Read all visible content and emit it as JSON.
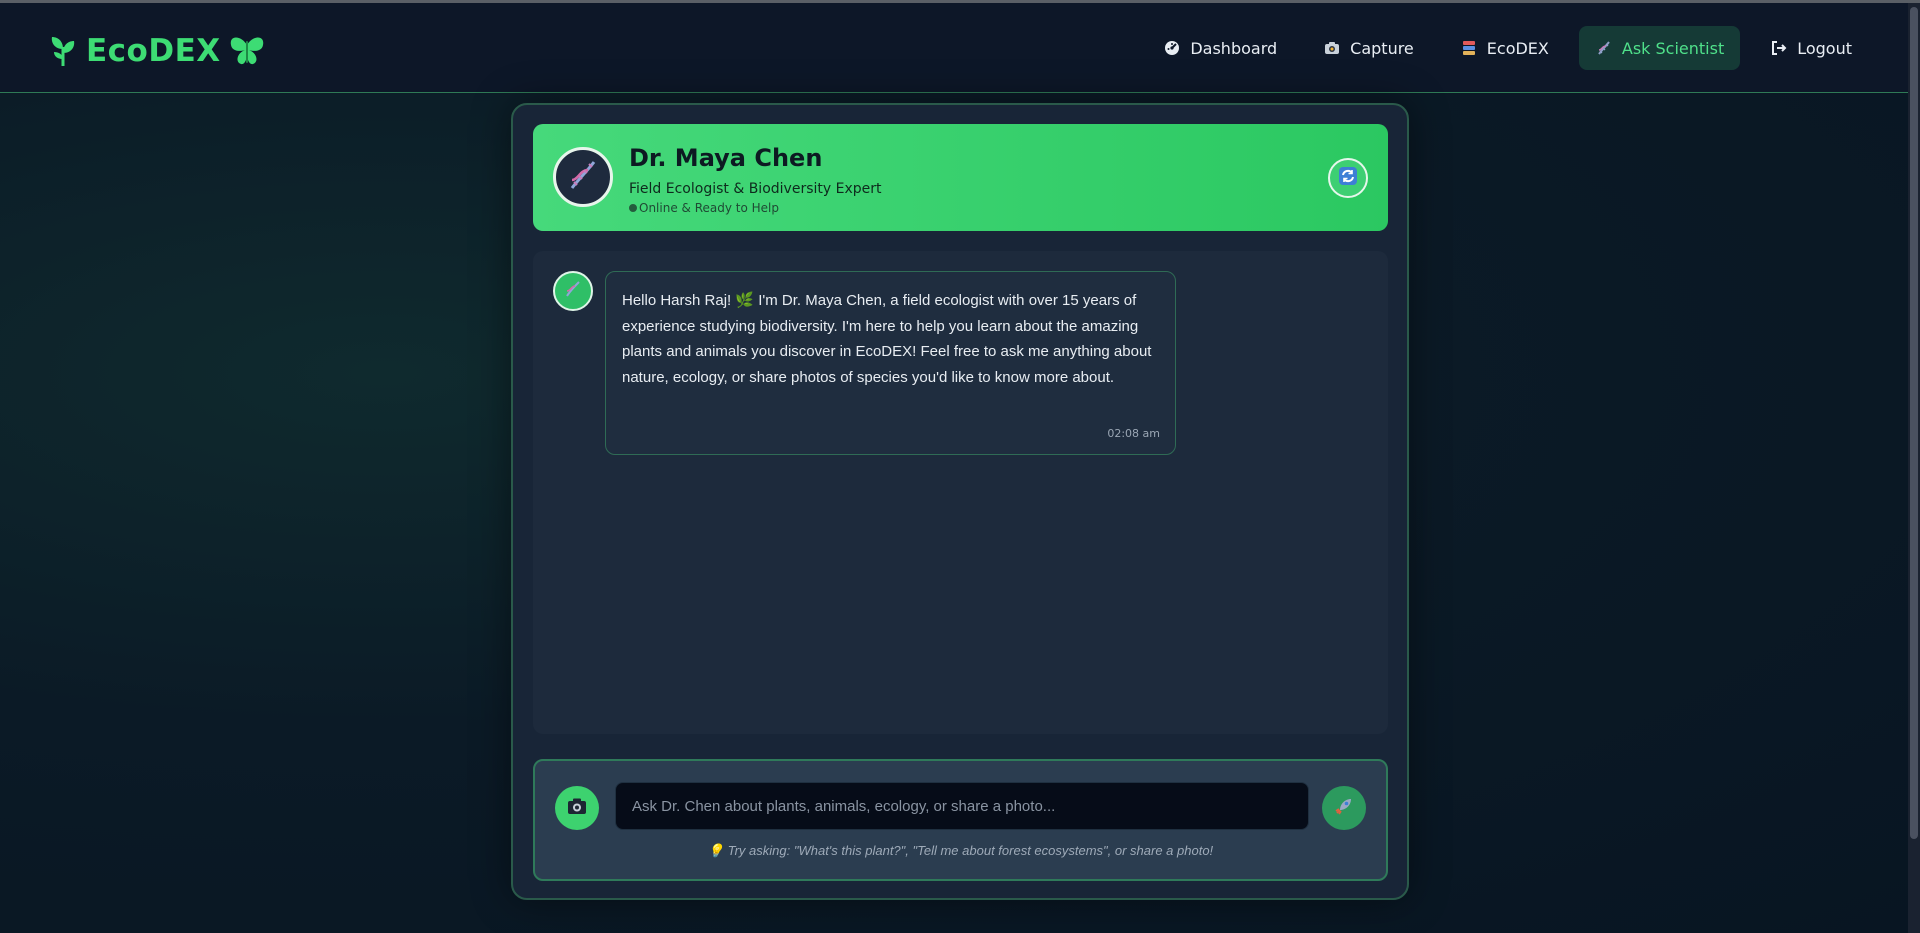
{
  "app": {
    "brand": "EcoDEX",
    "brand_color": "#3ddc74"
  },
  "nav": {
    "items": [
      {
        "label": "Dashboard",
        "icon": "dashboard-icon"
      },
      {
        "label": "Capture",
        "icon": "camera-icon"
      },
      {
        "label": "EcoDEX",
        "icon": "books-icon"
      },
      {
        "label": "Ask Scientist",
        "icon": "dna-icon",
        "active": true
      },
      {
        "label": "Logout",
        "icon": "logout-icon"
      }
    ]
  },
  "scientist": {
    "name": "Dr. Maya Chen",
    "title": "Field Ecologist & Biodiversity Expert",
    "status": "Online & Ready to Help"
  },
  "messages": [
    {
      "sender": "scientist",
      "text": "Hello Harsh Raj! 🌿 I'm Dr. Maya Chen, a field ecologist with over 15 years of experience studying biodiversity. I'm here to help you learn about the amazing plants and animals you discover in EcoDEX! Feel free to ask me anything about nature, ecology, or share photos of species you'd like to know more about.",
      "time": "02:08 am"
    }
  ],
  "composer": {
    "placeholder": "Ask Dr. Chen about plants, animals, ecology, or share a photo...",
    "value": "",
    "hint": "💡 Try asking: \"What's this plant?\", \"Tell me about forest ecosystems\", or share a photo!"
  },
  "colors": {
    "accent": "#2bc861",
    "panel": "#182537",
    "background": "#0b1a26"
  }
}
